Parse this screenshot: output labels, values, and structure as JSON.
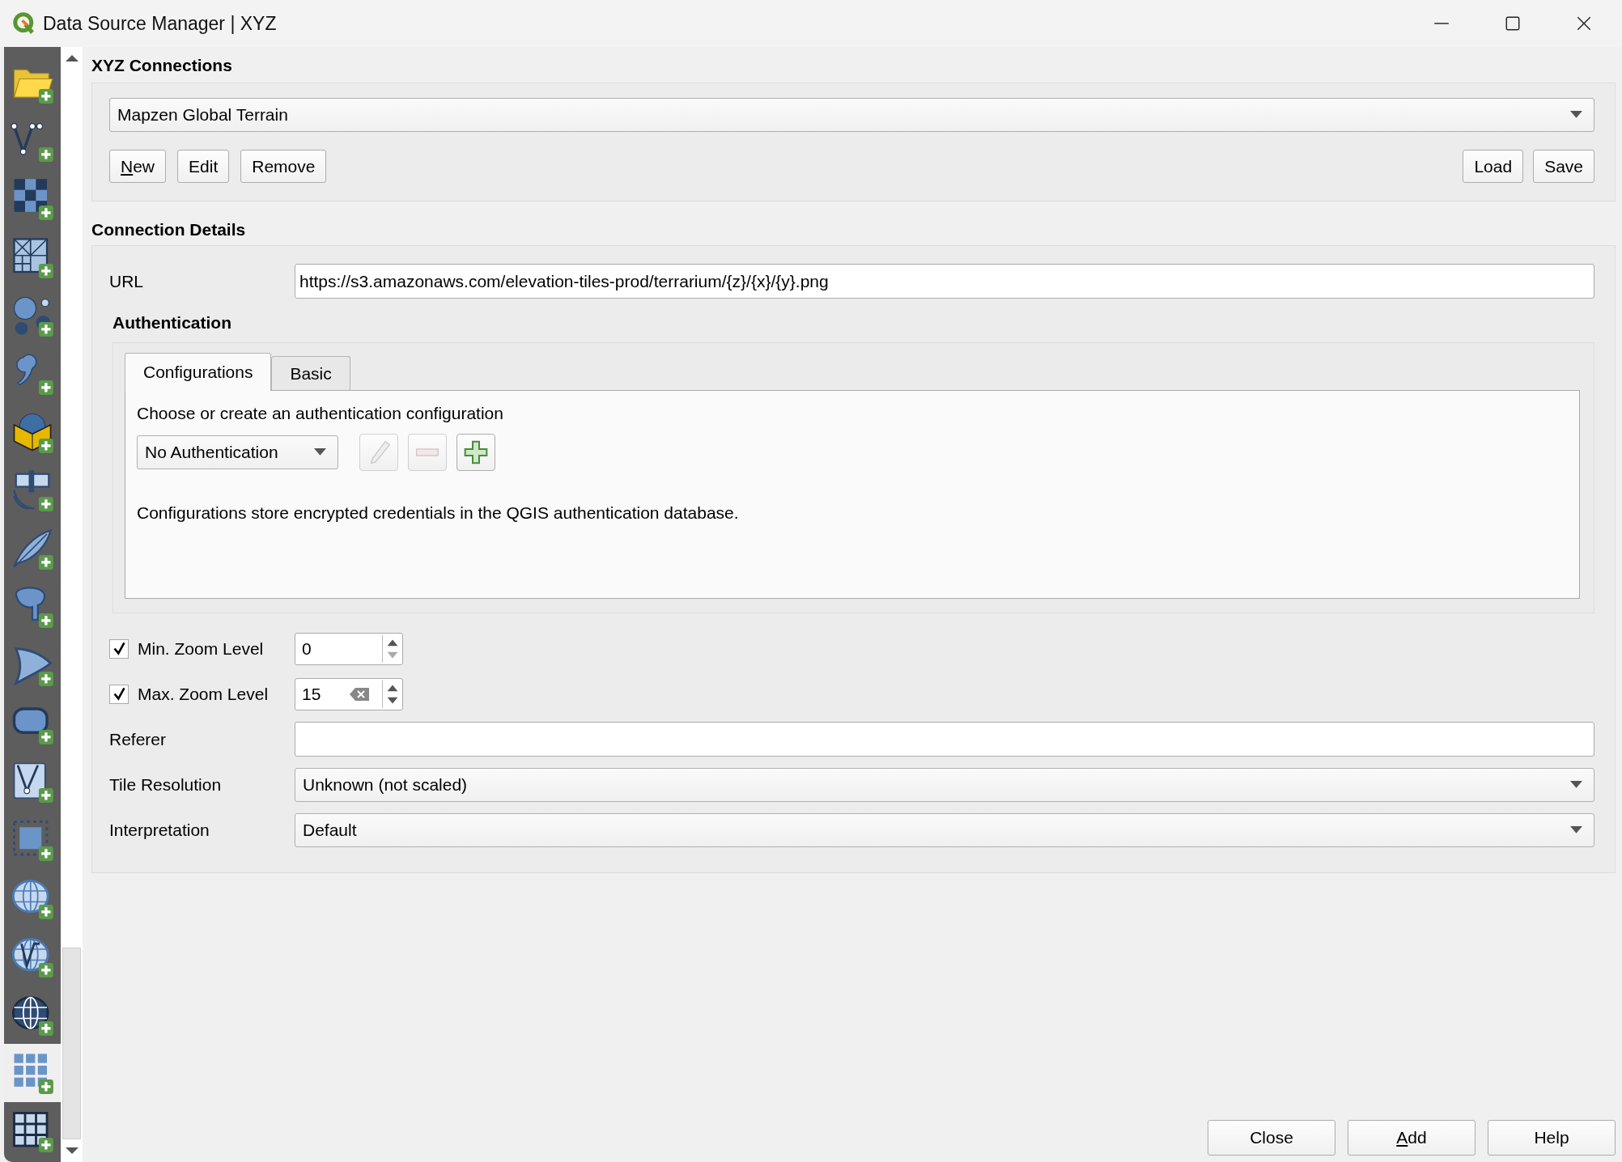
{
  "window": {
    "title": "Data Source Manager | XYZ"
  },
  "sidebar": {
    "items": [
      {
        "kind": "folder",
        "selected": false
      },
      {
        "kind": "vector",
        "selected": false
      },
      {
        "kind": "raster",
        "selected": false
      },
      {
        "kind": "mesh",
        "selected": false
      },
      {
        "kind": "pointcloud",
        "selected": false
      },
      {
        "kind": "delimited",
        "selected": false
      },
      {
        "kind": "geopackage",
        "selected": false
      },
      {
        "kind": "gps",
        "selected": false
      },
      {
        "kind": "spatialite",
        "selected": false
      },
      {
        "kind": "postgres",
        "selected": false
      },
      {
        "kind": "mssql",
        "selected": false
      },
      {
        "kind": "rounded",
        "selected": false
      },
      {
        "kind": "virtual",
        "selected": false
      },
      {
        "kind": "tile",
        "selected": false
      },
      {
        "kind": "wms",
        "selected": false
      },
      {
        "kind": "wfs",
        "selected": false
      },
      {
        "kind": "arcgis",
        "selected": false
      },
      {
        "kind": "xyz",
        "selected": true
      },
      {
        "kind": "vectortile",
        "selected": false
      }
    ]
  },
  "connections": {
    "heading": "XYZ Connections",
    "selected_connection": "Mapzen Global Terrain",
    "buttons": [
      {
        "label": "New",
        "mnemonic": true
      },
      {
        "label": "Edit",
        "mnemonic": false
      },
      {
        "label": "Remove",
        "mnemonic": false
      }
    ],
    "file_buttons": [
      {
        "label": "Load",
        "mnemonic": false
      },
      {
        "label": "Save",
        "mnemonic": false
      }
    ]
  },
  "details": {
    "heading": "Connection Details",
    "url_label": "URL",
    "url": "https://s3.amazonaws.com/elevation-tiles-prod/terrarium/{z}/{x}/{y}.png",
    "authentication": {
      "heading": "Authentication",
      "tabs": [
        {
          "label": "Configurations",
          "selected": true
        },
        {
          "label": "Basic",
          "selected": false
        }
      ],
      "prompt": "Choose or create an authentication configuration",
      "config": "No Authentication",
      "tool_buttons": [
        {
          "kind": "edit",
          "disabled": true
        },
        {
          "kind": "remove",
          "disabled": true
        },
        {
          "kind": "add",
          "disabled": false
        }
      ],
      "note": "Configurations store encrypted credentials in the QGIS authentication database."
    },
    "zoom_levels": [
      {
        "label": "Min. Zoom Level",
        "checked": true,
        "value": "0",
        "clear_button": false,
        "down_disabled": true
      },
      {
        "label": "Max. Zoom Level",
        "checked": true,
        "value": "15",
        "clear_button": true,
        "down_disabled": false
      }
    ],
    "referer": {
      "label": "Referer"
    },
    "tile_resolution": {
      "label": "Tile Resolution",
      "value": "Unknown (not scaled)"
    },
    "interpretation": {
      "label": "Interpretation",
      "value": "Default"
    }
  },
  "footer": {
    "buttons": [
      {
        "label": "Close",
        "mnemonic": false
      },
      {
        "label": "Add",
        "mnemonic": true
      },
      {
        "label": "Help",
        "mnemonic": false
      }
    ]
  }
}
